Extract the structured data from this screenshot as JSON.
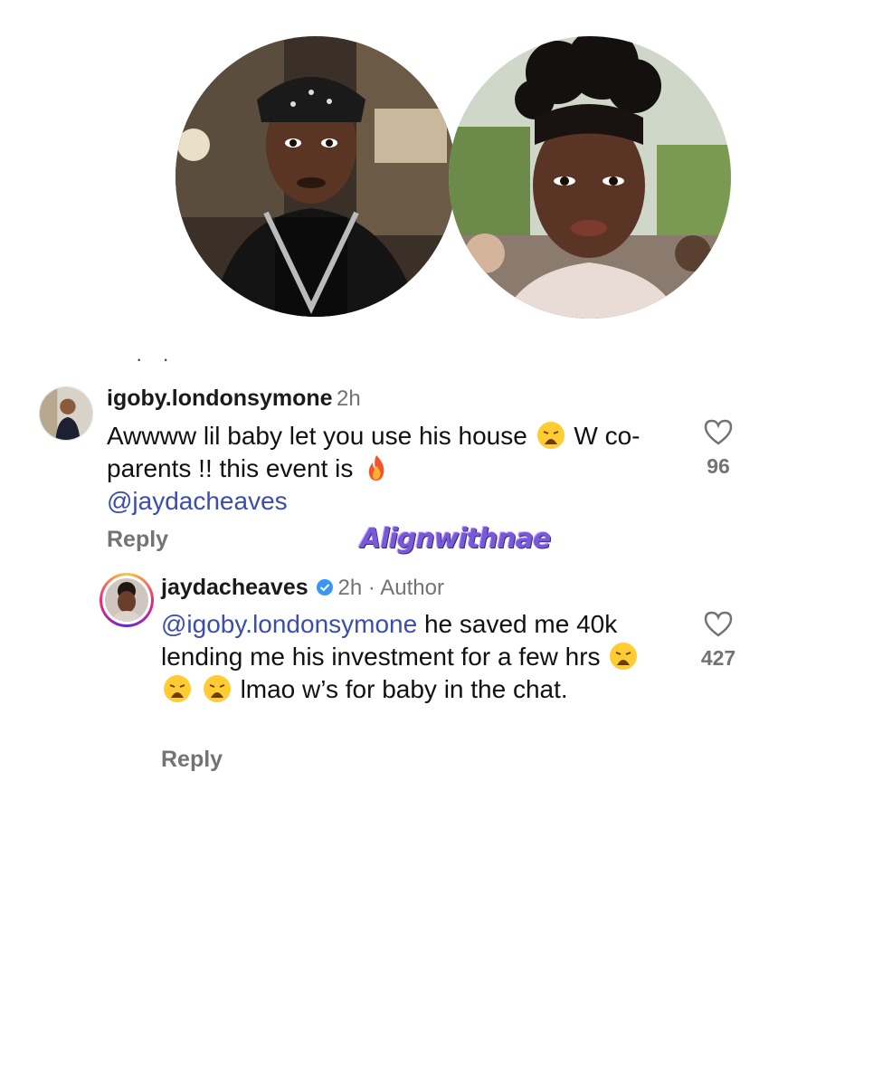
{
  "comments": [
    {
      "username": "igoby.londonsymone",
      "time": "2h",
      "text_part1": "Awwww lil baby let you use his house",
      "text_part2": "W co-parents !! this event is",
      "mention": "@jaydacheaves",
      "reply_label": "Reply",
      "likes": "96"
    },
    {
      "username": "jaydacheaves",
      "time": "2h · Author",
      "mention": "@igoby.londonsymone",
      "text_part1": "he saved me 40k lending me his investment for a few hrs",
      "text_part2": "lmao w’s for baby in the chat.",
      "reply_label": "Reply",
      "likes": "427"
    }
  ],
  "watermark": "Alignwithnae",
  "colors": {
    "mention": "#3b4db0",
    "muted": "#737373",
    "verified": "#3897f0"
  },
  "icons": [
    "heart-outline-icon",
    "verified-badge-icon",
    "weary-face-emoji",
    "fire-emoji"
  ]
}
